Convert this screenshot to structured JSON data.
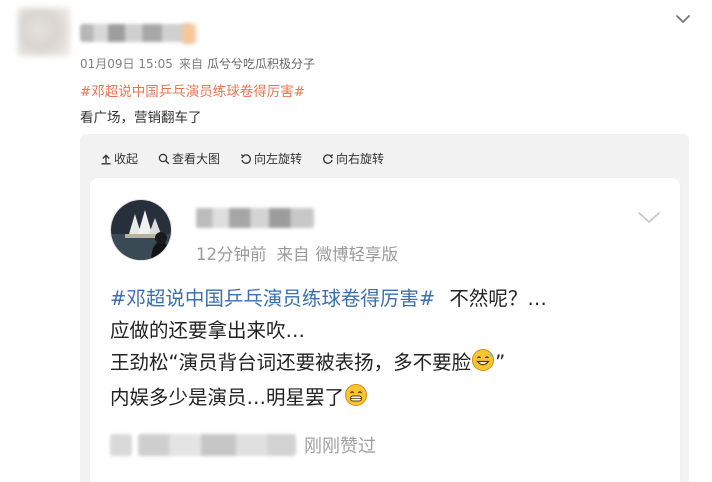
{
  "post": {
    "timestamp": "01月09日 15:05",
    "source_prefix": "来自",
    "source_name": "瓜兮兮吃瓜积极分子",
    "hashtag": "#邓超说中国乒乓演员练球卷得厉害#",
    "text": "看广场，营销翻车了"
  },
  "viewer_toolbar": {
    "collapse": "收起",
    "view_large": "查看大图",
    "rotate_left": "向左旋转",
    "rotate_right": "向右旋转"
  },
  "embedded_post": {
    "time_ago": "12分钟前",
    "source_prefix": "来自",
    "source_name": "微博轻享版",
    "hashtag": "#邓超说中国乒乓演员练球卷得厉害#",
    "line1_rest": "不然呢？…",
    "line2": "应做的还要拿出来吹…",
    "line3": "王劲松“演员背台词还要被表扬，多不要脸",
    "line3_end": "”",
    "line4": "内娱多少是演员…明星罢了",
    "likes_suffix": "刚刚赞过"
  },
  "colors": {
    "hashtag_orange": "#eb7350",
    "hashtag_blue": "#3a6fb0",
    "viewer_bg": "#f2f2f2"
  },
  "icons": [
    "chevron-down-icon",
    "arrow-up-icon",
    "magnifier-icon",
    "rotate-left-icon",
    "rotate-right-icon",
    "sweat-smile-emoji",
    "grin-emoji"
  ]
}
